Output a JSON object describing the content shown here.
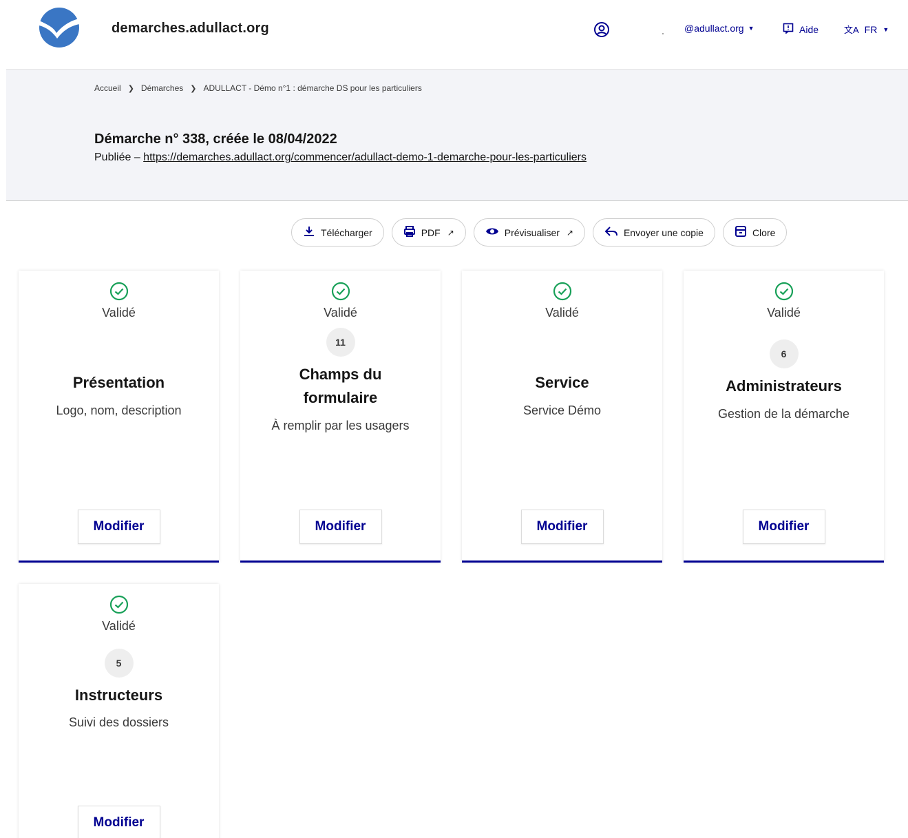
{
  "header": {
    "site_name": "demarches.adullact.org",
    "user_email": "@adullact.org",
    "help_label": "Aide",
    "lang_label": "FR"
  },
  "breadcrumb": {
    "items": [
      "Accueil",
      "Démarches",
      "ADULLACT - Démo n°1 : démarche DS pour les particuliers"
    ]
  },
  "hero": {
    "title": "Démarche n° 338, créée le 08/04/2022",
    "status_prefix": "Publiée – ",
    "url": "https://demarches.adullact.org/commencer/adullact-demo-1-demarche-pour-les-particuliers"
  },
  "toolbar": {
    "download": "Télécharger",
    "pdf": "PDF",
    "preview": "Prévisualiser",
    "send_copy": "Envoyer une copie",
    "close": "Clore"
  },
  "cards": [
    {
      "status": "Validé",
      "count": "",
      "title": "Présentation",
      "desc": "Logo, nom, description",
      "button": "Modifier"
    },
    {
      "status": "Validé",
      "count": "11",
      "title": "Champs du formulaire",
      "desc": "À remplir par les usagers",
      "button": "Modifier"
    },
    {
      "status": "Validé",
      "count": "",
      "title": "Service",
      "desc": "Service Démo",
      "button": "Modifier"
    },
    {
      "status": "Validé",
      "count": "6",
      "title": "Administrateurs",
      "desc": "Gestion de la démarche",
      "button": "Modifier"
    },
    {
      "status": "Validé",
      "count": "5",
      "title": "Instructeurs",
      "desc": "Suivi des dossiers",
      "button": "Modifier"
    }
  ],
  "colors": {
    "accent": "#000091",
    "success": "#18a058",
    "hero_bg": "#f3f4f8"
  }
}
